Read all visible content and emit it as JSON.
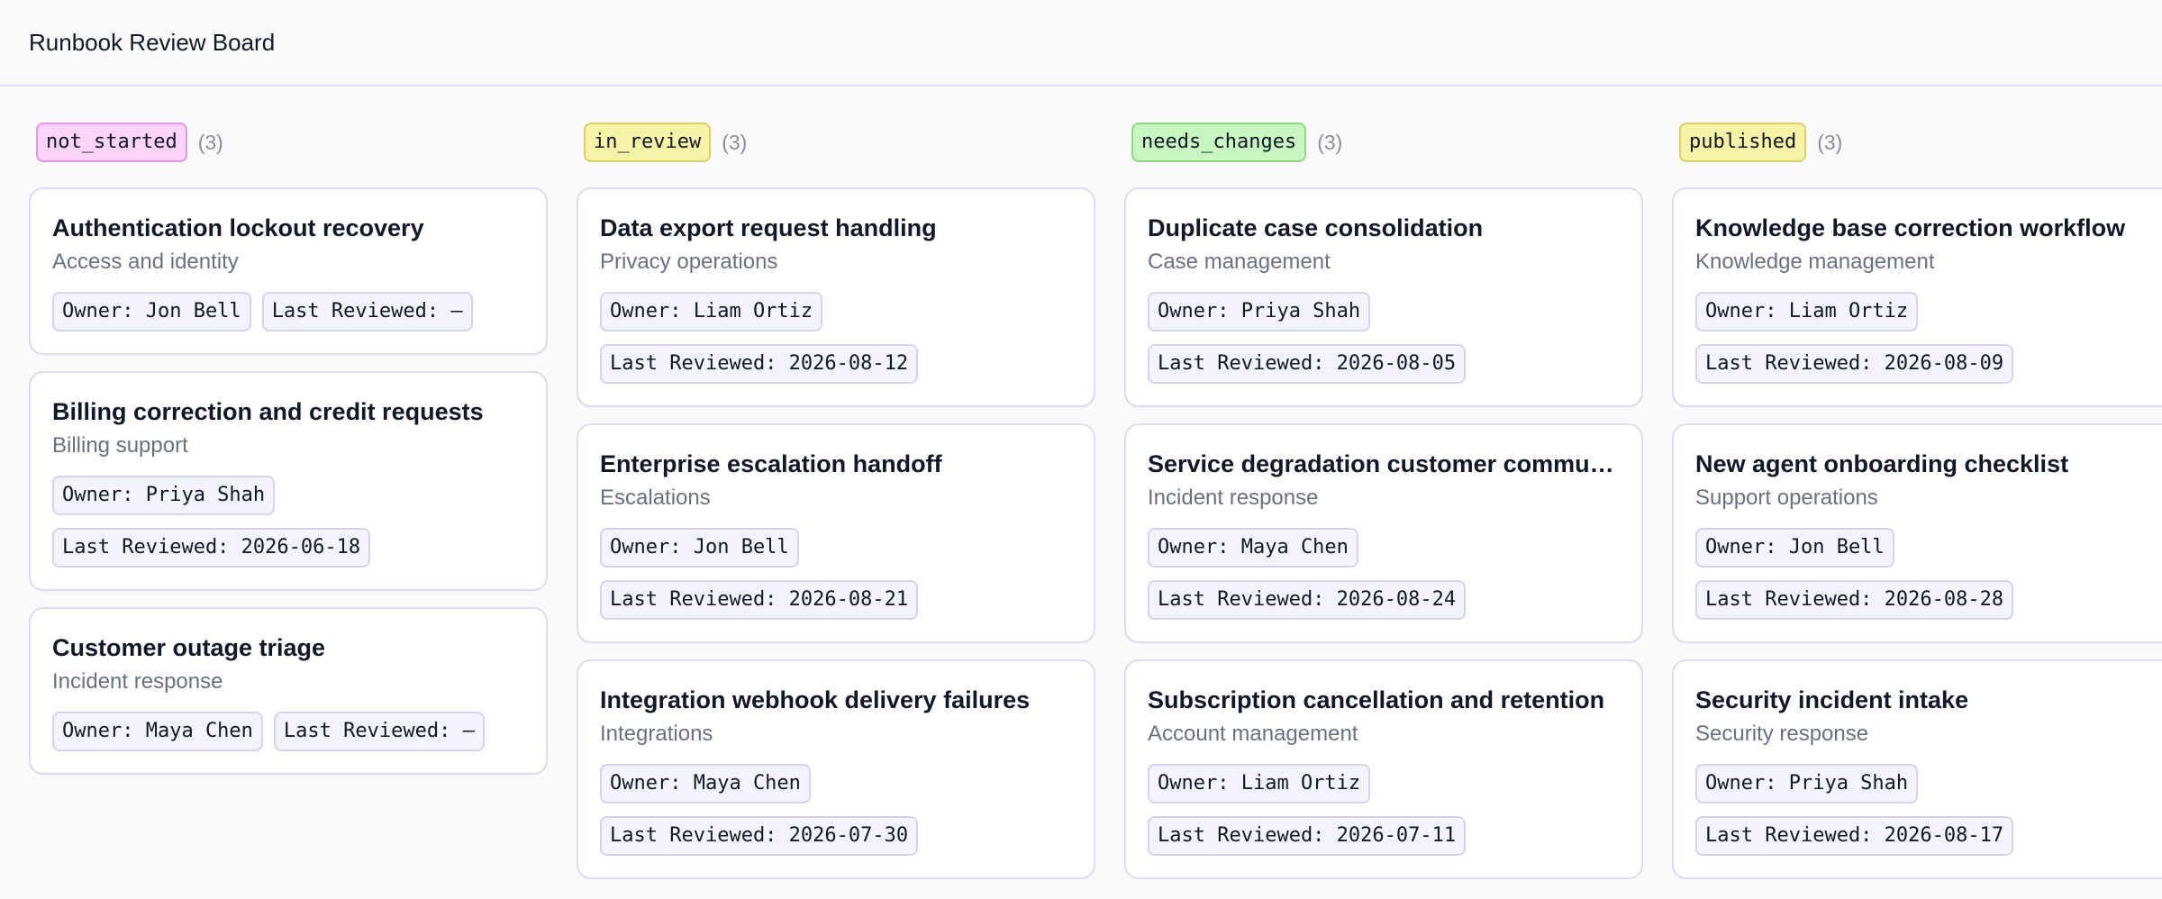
{
  "app": {
    "title": "Runbook Review Board"
  },
  "columns": [
    {
      "status": "not_started",
      "count": "(3)",
      "badge_bg": "#fbd3fb",
      "badge_border": "#e596e5",
      "cards": [
        {
          "title": "Authentication lockout recovery",
          "category": "Access and identity",
          "owner": "Owner: Jon Bell",
          "reviewed": "Last Reviewed: –"
        },
        {
          "title": "Billing correction and credit requests",
          "category": "Billing support",
          "owner": "Owner: Priya Shah",
          "reviewed": "Last Reviewed: 2026-06-18"
        },
        {
          "title": "Customer outage triage",
          "category": "Incident response",
          "owner": "Owner: Maya Chen",
          "reviewed": "Last Reviewed: –"
        }
      ]
    },
    {
      "status": "in_review",
      "count": "(3)",
      "badge_bg": "#f7f3a6",
      "badge_border": "#d8cf6a",
      "cards": [
        {
          "title": "Data export request handling",
          "category": "Privacy operations",
          "owner": "Owner: Liam Ortiz",
          "reviewed": "Last Reviewed: 2026-08-12"
        },
        {
          "title": "Enterprise escalation handoff",
          "category": "Escalations",
          "owner": "Owner: Jon Bell",
          "reviewed": "Last Reviewed: 2026-08-21"
        },
        {
          "title": "Integration webhook delivery failures",
          "category": "Integrations",
          "owner": "Owner: Maya Chen",
          "reviewed": "Last Reviewed: 2026-07-30"
        }
      ]
    },
    {
      "status": "needs_changes",
      "count": "(3)",
      "badge_bg": "#c9f5c0",
      "badge_border": "#8fd784",
      "cards": [
        {
          "title": "Duplicate case consolidation",
          "category": "Case management",
          "owner": "Owner: Priya Shah",
          "reviewed": "Last Reviewed: 2026-08-05"
        },
        {
          "title": "Service degradation customer communication",
          "category": "Incident response",
          "owner": "Owner: Maya Chen",
          "reviewed": "Last Reviewed: 2026-08-24"
        },
        {
          "title": "Subscription cancellation and retention",
          "category": "Account management",
          "owner": "Owner: Liam Ortiz",
          "reviewed": "Last Reviewed: 2026-07-11"
        }
      ]
    },
    {
      "status": "published",
      "count": "(3)",
      "badge_bg": "#f7f3a6",
      "badge_border": "#d8cf6a",
      "cards": [
        {
          "title": "Knowledge base correction workflow",
          "category": "Knowledge management",
          "owner": "Owner: Liam Ortiz",
          "reviewed": "Last Reviewed: 2026-08-09"
        },
        {
          "title": "New agent onboarding checklist",
          "category": "Support operations",
          "owner": "Owner: Jon Bell",
          "reviewed": "Last Reviewed: 2026-08-28"
        },
        {
          "title": "Security incident intake",
          "category": "Security response",
          "owner": "Owner: Priya Shah",
          "reviewed": "Last Reviewed: 2026-08-17"
        }
      ]
    }
  ]
}
